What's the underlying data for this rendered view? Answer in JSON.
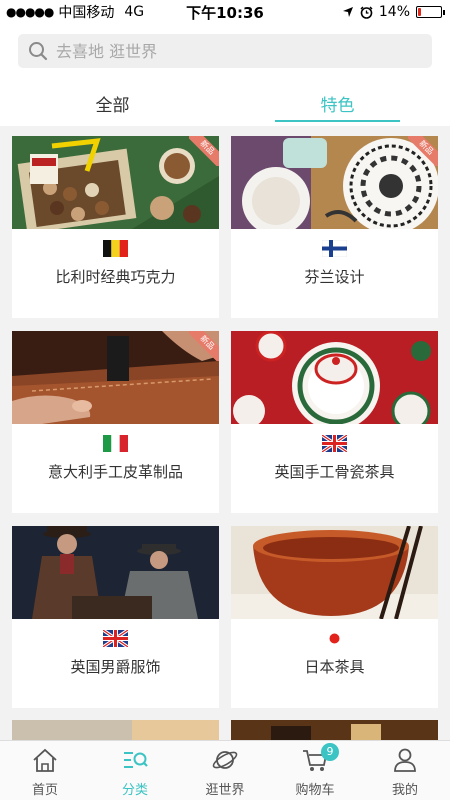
{
  "status_bar": {
    "signal": "●●●●●",
    "carrier": "中国移动",
    "network": "4G",
    "time": "下午10:36",
    "battery": "14%",
    "battery_level": 0.14
  },
  "search": {
    "placeholder": "去喜地 逛世界"
  },
  "tabs": [
    {
      "label": "全部",
      "active": false
    },
    {
      "label": "特色",
      "active": true
    }
  ],
  "cards": [
    {
      "title": "比利时经典巧克力",
      "flag": "belgium-flag-icon",
      "new_tag": "新品"
    },
    {
      "title": "芬兰设计",
      "flag": "finland-flag-icon",
      "new_tag": "新品"
    },
    {
      "title": "意大利手工皮革制品",
      "flag": "italy-flag-icon",
      "new_tag": "新品"
    },
    {
      "title": "英国手工骨瓷茶具",
      "flag": "uk-flag-icon"
    },
    {
      "title": "英国男爵服饰",
      "flag": "uk-flag-icon"
    },
    {
      "title": "日本茶具",
      "flag": "japan-flag-icon"
    }
  ],
  "bottom_nav": [
    {
      "label": "首页",
      "icon": "home-icon"
    },
    {
      "label": "分类",
      "icon": "category-icon",
      "active": true
    },
    {
      "label": "逛世界",
      "icon": "planet-icon"
    },
    {
      "label": "购物车",
      "icon": "cart-icon",
      "badge": "9"
    },
    {
      "label": "我的",
      "icon": "user-icon"
    }
  ],
  "colors": {
    "accent": "#3cc3c3",
    "new_tag": "#e77b6a",
    "battery_low": "#e0261b"
  }
}
